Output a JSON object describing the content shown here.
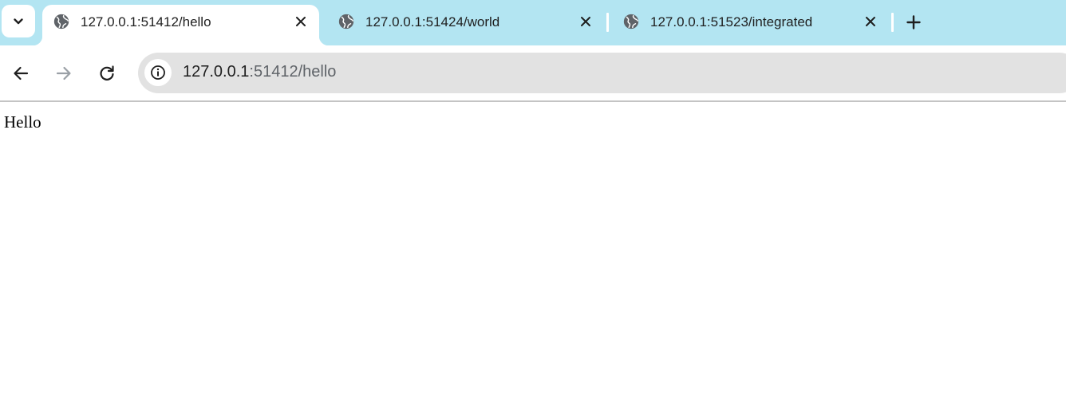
{
  "tabs": [
    {
      "title": "127.0.0.1:51412/hello",
      "favicon": "globe-icon",
      "active": true
    },
    {
      "title": "127.0.0.1:51424/world",
      "favicon": "globe-icon",
      "active": false
    },
    {
      "title": "127.0.0.1:51523/integrated",
      "favicon": "globe-icon",
      "active": false
    }
  ],
  "toolbar": {
    "back_icon": "back-arrow-icon",
    "forward_icon": "forward-arrow-icon",
    "reload_icon": "reload-icon",
    "site_info_icon": "info-icon"
  },
  "address_bar": {
    "host": "127.0.0.1",
    "rest": ":51412/hello"
  },
  "page": {
    "text": "Hello"
  },
  "colors": {
    "tabstrip_bg": "#b3e5f2",
    "omnibox_bg": "#e2e2e2",
    "icon_color": "#1f1f1f",
    "disabled_icon": "#9aa0a6",
    "favicon_color": "#5f6368"
  }
}
